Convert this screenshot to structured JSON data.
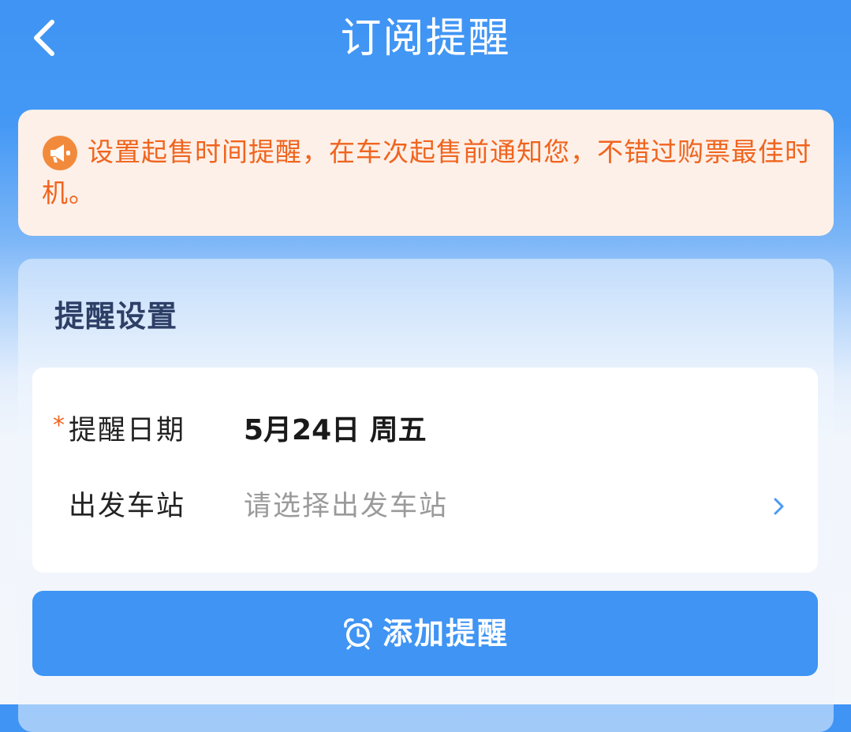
{
  "header": {
    "title": "订阅提醒",
    "back_icon": "chevron-left-icon"
  },
  "notice": {
    "icon": "megaphone-icon",
    "text": "设置起售时间提醒，在车次起售前通知您，不错过购票最佳时机。"
  },
  "settings": {
    "section_title": "提醒设置",
    "date_row": {
      "required_mark": "*",
      "label": "提醒日期",
      "value": "5月24日 周五"
    },
    "station_row": {
      "label": "出发车站",
      "placeholder": "请选择出发车站",
      "chevron_icon": "chevron-right-icon"
    }
  },
  "add_button": {
    "icon": "alarm-clock-icon",
    "label": "添加提醒"
  },
  "colors": {
    "primary_blue": "#3f94f4",
    "notice_orange": "#f0641e",
    "notice_bg": "#fdf0e8",
    "section_title": "#2d3f66",
    "placeholder_gray": "#9a9a9a"
  }
}
